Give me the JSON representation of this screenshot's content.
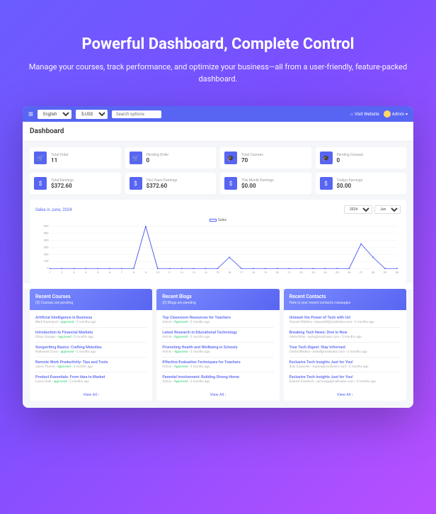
{
  "hero": {
    "title": "Powerful Dashboard, Complete Control",
    "subtitle": "Manage your courses, track performance, and optimize your business—all from a user-friendly, feature-packed dashboard."
  },
  "topbar": {
    "lang": "English",
    "currency": "$-USD",
    "search_ph": "Search options",
    "visit": "Visit Website",
    "user": "Admin"
  },
  "page_title": "Dashboard",
  "stats": [
    {
      "label": "Total Order",
      "value": "11",
      "icon": "🛒"
    },
    {
      "label": "Pending Order",
      "value": "0",
      "icon": "🛒"
    },
    {
      "label": "Total Courses",
      "value": "70",
      "icon": "🎓"
    },
    {
      "label": "Pending Courses",
      "value": "0",
      "icon": "🎓"
    },
    {
      "label": "Total Earnings",
      "value": "$372.60",
      "icon": "$"
    },
    {
      "label": "This Years Earnings",
      "value": "$372.60",
      "icon": "$"
    },
    {
      "label": "This Month Earnings",
      "value": "$0.00",
      "icon": "$"
    },
    {
      "label": "Todays Earnings",
      "value": "$0.00",
      "icon": "$"
    }
  ],
  "chart_data": {
    "type": "line",
    "title": "Sales in June, 2024",
    "year": "2024",
    "month": "Jun",
    "legend": "Sales",
    "x": [
      1,
      2,
      3,
      4,
      5,
      6,
      7,
      8,
      9,
      10,
      11,
      12,
      13,
      14,
      15,
      16,
      17,
      18,
      19,
      20,
      21,
      22,
      23,
      24,
      25,
      26,
      27,
      28,
      29,
      30
    ],
    "y": [
      0,
      0,
      0,
      0,
      0,
      0,
      0,
      0,
      600,
      0,
      0,
      0,
      0,
      0,
      0,
      160,
      0,
      0,
      0,
      0,
      0,
      0,
      0,
      0,
      0,
      0,
      350,
      160,
      0,
      0
    ],
    "xlabel": "",
    "ylabel": "",
    "ylim": [
      0,
      600
    ],
    "yticks": [
      0,
      100,
      200,
      300,
      400,
      500,
      600
    ]
  },
  "panels": [
    {
      "title": "Recent Courses",
      "sub": "(0) Courses are pending",
      "items": [
        {
          "t": "Artificial Intelligence in Business",
          "a": "Mark Davenport",
          "s": "approved",
          "d": "2 months ago"
        },
        {
          "t": "Introduction to Financial Markets",
          "a": "Ethan Granger",
          "s": "approved",
          "d": "2 months ago"
        },
        {
          "t": "Songwriting Basics: Crafting Melodies",
          "a": "Nathaniel Cross",
          "s": "approved",
          "d": "2 months ago"
        },
        {
          "t": "Remote Work Productivity: Tips and Tools",
          "a": "Jason Thorne",
          "s": "approved",
          "d": "2 months ago"
        },
        {
          "t": "Product Essentials: From Idea to Market",
          "a": "Lucas Hale",
          "s": "approved",
          "d": "2 months ago"
        }
      ],
      "view": "View All"
    },
    {
      "title": "Recent Blogs",
      "sub": "(0) Blogs are pending",
      "items": [
        {
          "t": "Top Classroom Resources for Teachers",
          "a": "Admin",
          "s": "Approved",
          "d": "3 months ago"
        },
        {
          "t": "Latest Research in Educational Technology",
          "a": "Admin",
          "s": "Approved",
          "d": "3 months ago"
        },
        {
          "t": "Promoting Health and Wellbeing in Schools",
          "a": "Admin",
          "s": "Approved",
          "d": "3 months ago"
        },
        {
          "t": "Effective Evaluation Techniques for Teachers",
          "a": "Admin",
          "s": "Approved",
          "d": "3 months ago"
        },
        {
          "t": "Parental Involvement: Building Strong Home",
          "a": "Admin",
          "s": "Approved",
          "d": "3 months ago"
        }
      ],
      "view": "View All"
    },
    {
      "title": "Recent Contacts",
      "sub": "Here is your recent contacts messages",
      "items": [
        {
          "t": "Unleash the Power of Tech with Us!",
          "a": "Vincent Watkins",
          "e": "tepuwafit@mailinator.com",
          "d": "3 months ago"
        },
        {
          "t": "Breaking Tech News: Dive In Now",
          "a": "Adele Kirby",
          "e": "wyhu@mailinator.com",
          "d": "3 months ago"
        },
        {
          "t": "Your Tech Digest: Stay Informed",
          "a": "Cecilia Medina",
          "e": "bedaf@mailinator.com",
          "d": "3 months ago"
        },
        {
          "t": "Exclusive Tech Insights Just for You!",
          "a": "Suki Carpenter",
          "e": "tujowu@mailinator.com",
          "d": "3 months ago"
        },
        {
          "t": "Exclusive Tech Insights Just for You!",
          "a": "Edward Crawford",
          "e": "cymusigy@mailinator.com",
          "d": "3 months ago"
        }
      ],
      "view": "View All"
    }
  ]
}
